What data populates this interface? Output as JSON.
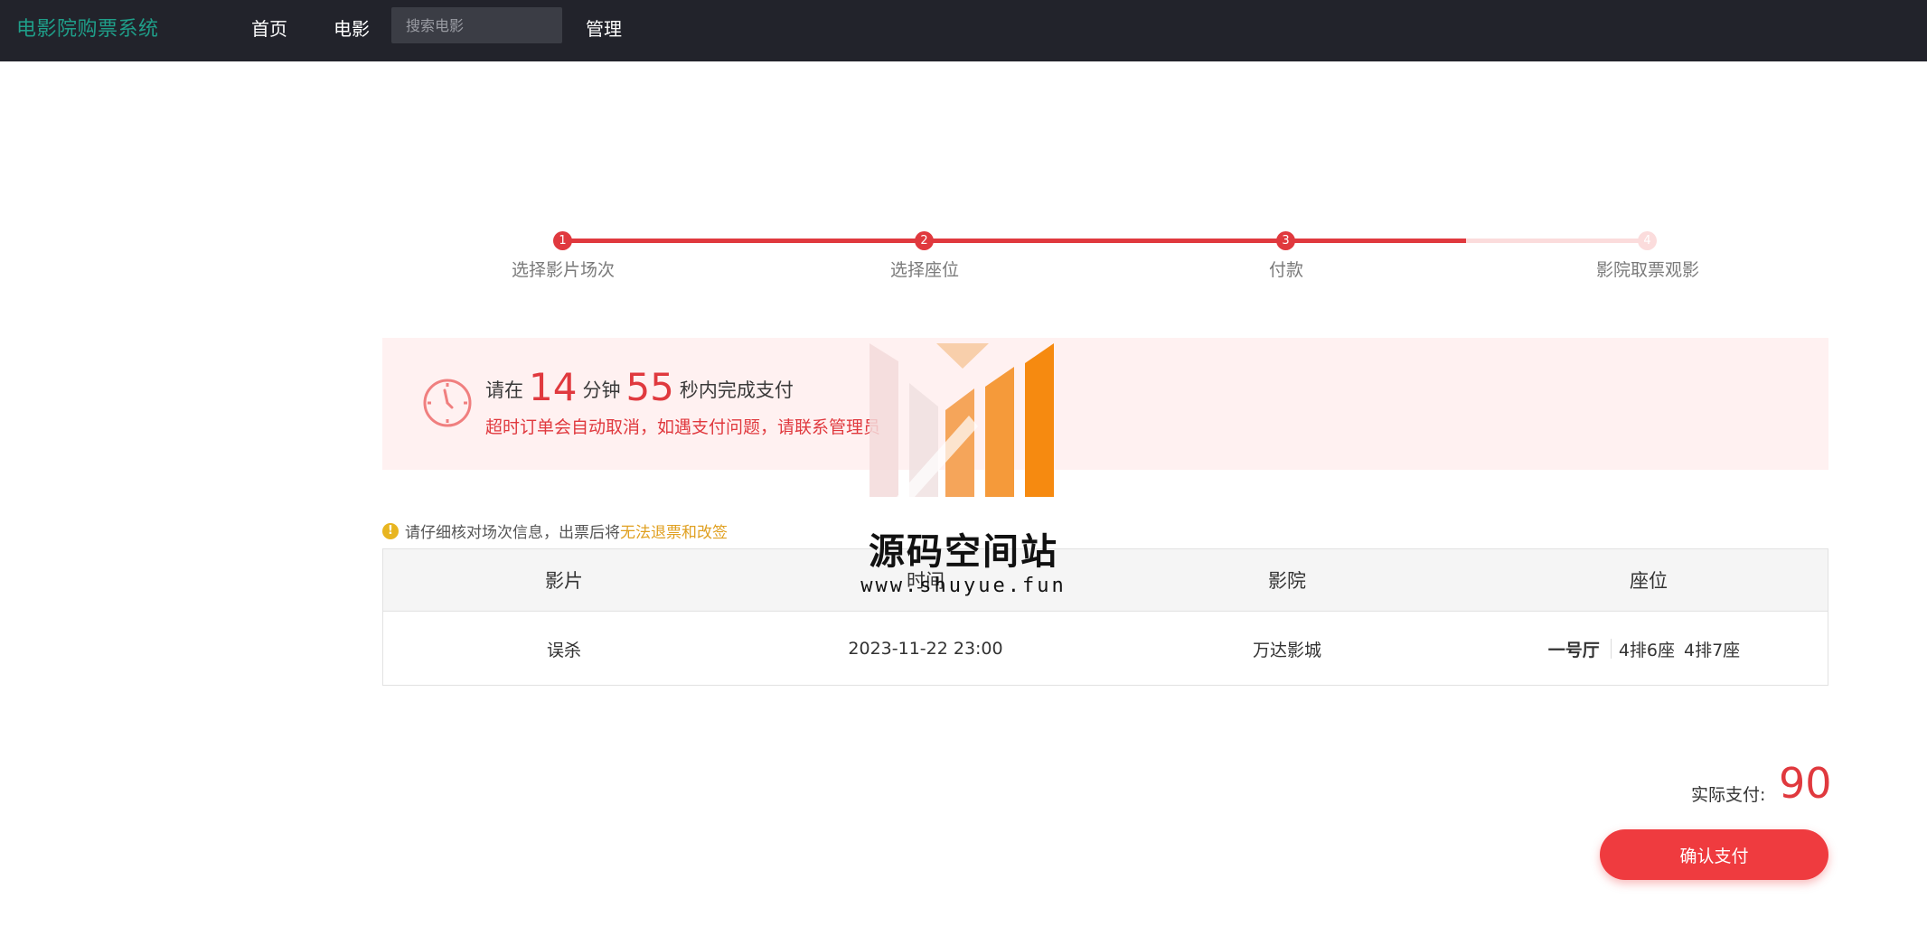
{
  "nav": {
    "brand": "电影院购票系统",
    "home": "首页",
    "movie": "电影",
    "search_placeholder": "搜索电影",
    "admin": "管理"
  },
  "steps": [
    {
      "num": "1",
      "label": "选择影片场次",
      "state": "done"
    },
    {
      "num": "2",
      "label": "选择座位",
      "state": "done"
    },
    {
      "num": "3",
      "label": "付款",
      "state": "active"
    },
    {
      "num": "4",
      "label": "影院取票观影",
      "state": "todo"
    }
  ],
  "timer": {
    "prefix": "请在",
    "minutes": "14",
    "min_unit": "分钟",
    "seconds": "55",
    "suffix": "秒内完成支付",
    "warning": "超时订单会自动取消，如遇支付问题，请联系管理员"
  },
  "notice": {
    "text": "请仔细核对场次信息，出票后将",
    "highlight": "无法退票和改签"
  },
  "table": {
    "headers": [
      "影片",
      "时间",
      "影院",
      "座位"
    ],
    "row": {
      "movie": "误杀",
      "time": "2023-11-22 23:00",
      "cinema": "万达影城",
      "hall": "一号厅",
      "seats": [
        "4排6座",
        "4排7座"
      ]
    }
  },
  "payment": {
    "label": "实际支付:",
    "amount": "90",
    "confirm": "确认支付"
  },
  "watermark": {
    "title": "源码空间站",
    "url": "www.shuyue.fun"
  },
  "colors": {
    "accent": "#e0393e",
    "brand": "#1f9e89",
    "nav_bg": "#22232b",
    "panel_bg": "#fff1f1",
    "warn": "#e0a020"
  }
}
